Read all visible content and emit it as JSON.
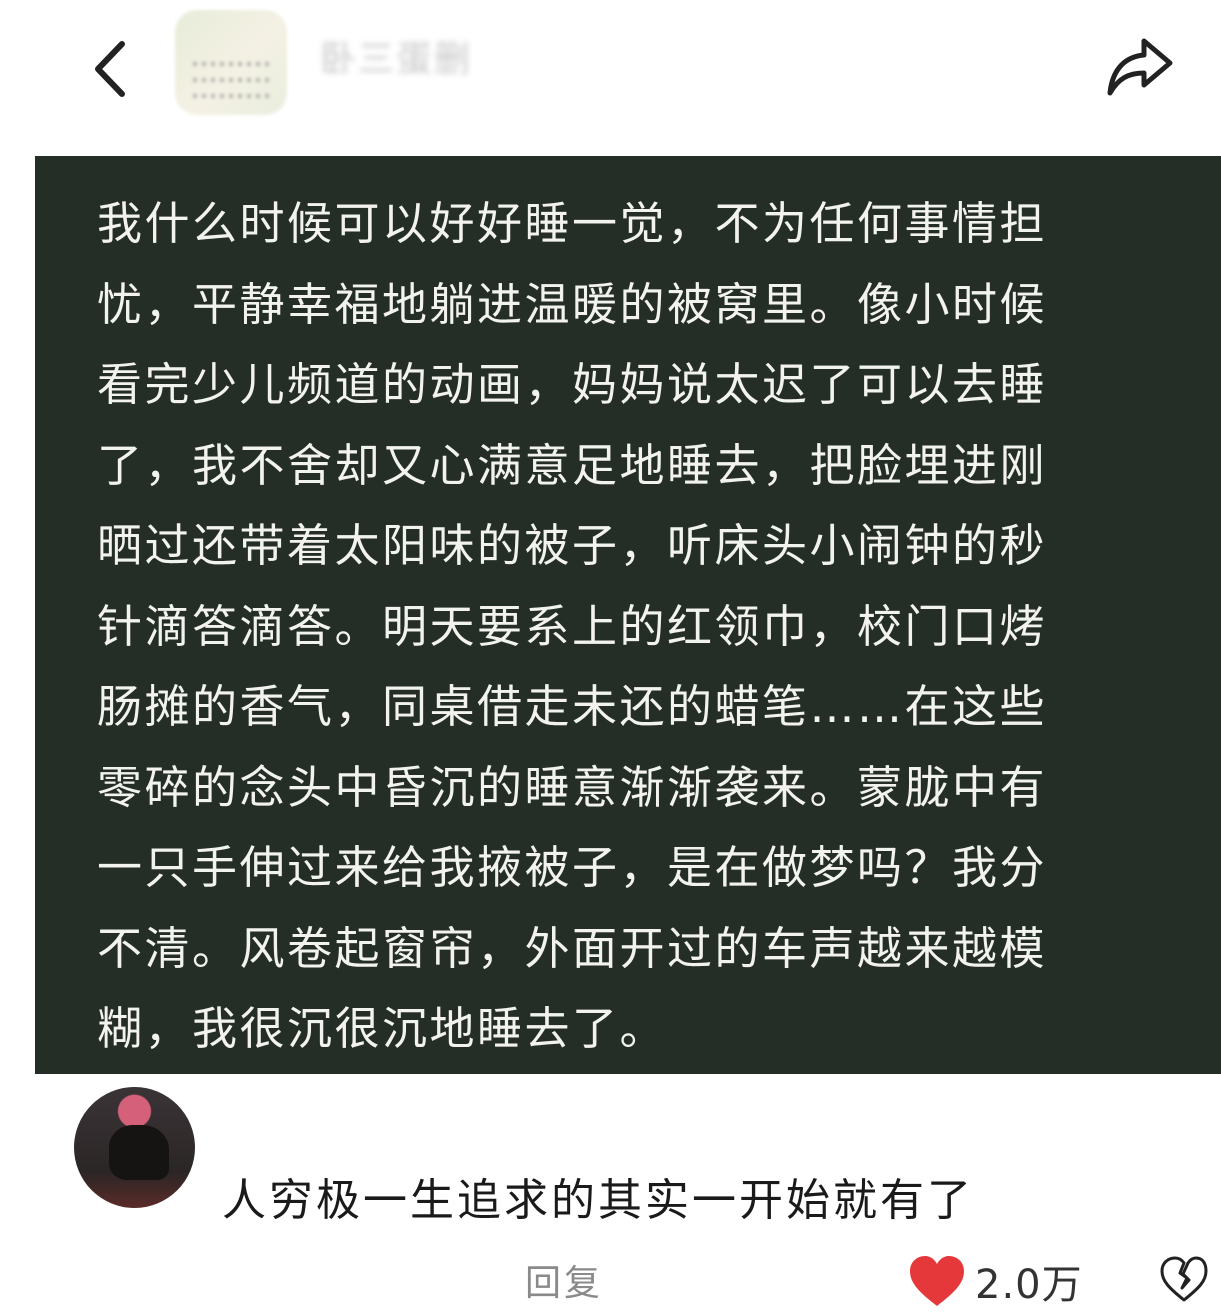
{
  "header": {
    "back_icon": "chevron-left-icon",
    "user_name_blurred": "卧三蛋删",
    "share_icon": "share-arrow-icon"
  },
  "post": {
    "text": "我什么时候可以好好睡一觉，不为任何事情担\n忧，平静幸福地躺进温暖的被窝里。像小时候\n看完少儿频道的动画，妈妈说太迟了可以去睡\n了，我不舍却又心满意足地睡去，把脸埋进刚\n晒过还带着太阳味的被子，听床头小闹钟的秒\n针滴答滴答。明天要系上的红领巾，校门口烤\n肠摊的香气，同桌借走未还的蜡笔……在这些\n零碎的念头中昏沉的睡意渐渐袭来。蒙胧中有\n一只手伸过来给我掖被子，是在做梦吗？我分\n不清。风卷起窗帘，外面开过的车声越来越模\n糊，我很沉很沉地睡去了。",
    "background_color": "#252d27",
    "text_color": "#f2f2ef"
  },
  "comment": {
    "text": "人穷极一生追求的其实一开始就有了",
    "reply_label": "回复",
    "like_count": "2.0万",
    "like_icon": "heart-icon",
    "like_color": "#e5383b",
    "dislike_icon": "broken-heart-icon"
  }
}
